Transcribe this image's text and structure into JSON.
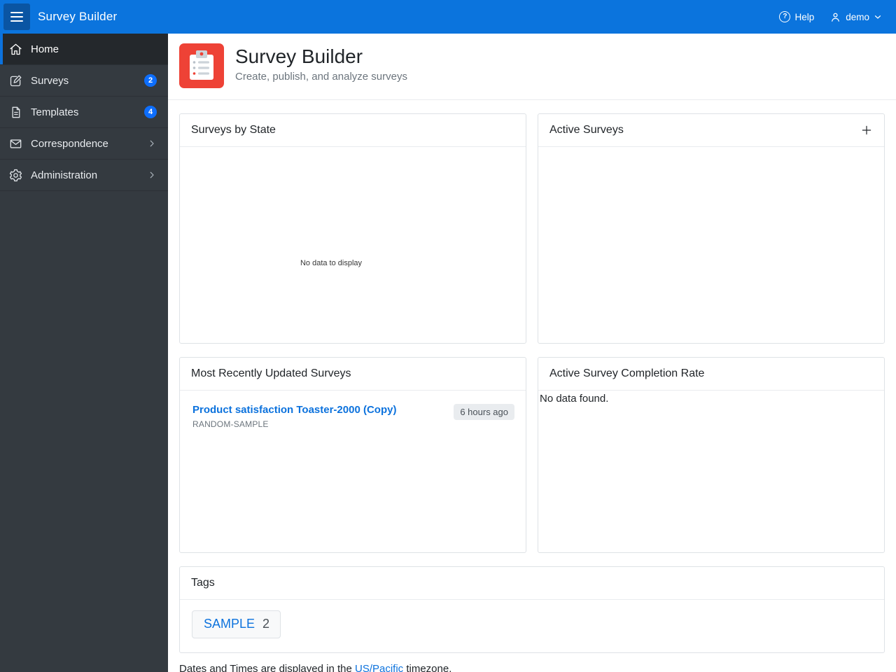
{
  "topbar": {
    "title": "Survey Builder",
    "help_label": "Help",
    "user_label": "demo"
  },
  "sidebar": {
    "items": [
      {
        "label": "Home",
        "icon": "home-icon",
        "active": true
      },
      {
        "label": "Surveys",
        "icon": "edit-icon",
        "badge": "2"
      },
      {
        "label": "Templates",
        "icon": "document-icon",
        "badge": "4"
      },
      {
        "label": "Correspondence",
        "icon": "envelope-icon",
        "expandable": true
      },
      {
        "label": "Administration",
        "icon": "gear-icon",
        "expandable": true
      }
    ]
  },
  "header": {
    "title": "Survey Builder",
    "subtitle": "Create, publish, and analyze surveys",
    "icon": "clipboard-icon"
  },
  "cards": {
    "surveys_by_state": {
      "title": "Surveys by State",
      "empty_text": "No data to display"
    },
    "active_surveys": {
      "title": "Active Surveys",
      "add_icon": "plus-icon"
    },
    "recent_surveys": {
      "title": "Most Recently Updated Surveys",
      "items": [
        {
          "name": "Product satisfaction Toaster-2000 (Copy)",
          "tag": "RANDOM-SAMPLE",
          "updated": "6 hours ago"
        }
      ]
    },
    "completion_rate": {
      "title": "Active Survey Completion Rate",
      "empty_text": "No data found."
    },
    "tags": {
      "title": "Tags",
      "items": [
        {
          "label": "SAMPLE",
          "count": "2"
        }
      ]
    }
  },
  "footer": {
    "text_before": "Dates and Times are displayed in the ",
    "link_text": "US/Pacific",
    "text_after": " timezone."
  },
  "colors": {
    "topbar_bg": "#0b74dd",
    "hamburger_bg": "#0a55a3",
    "sidebar_bg": "#343a40",
    "sidebar_active_bg": "#24282c",
    "accent_blue": "#0c72dd",
    "badge_blue": "#0d6efd",
    "app_icon_red": "#ee4236",
    "card_border": "#dee2e6",
    "time_badge_bg": "#e9ecef",
    "muted_text": "#6c757d"
  }
}
